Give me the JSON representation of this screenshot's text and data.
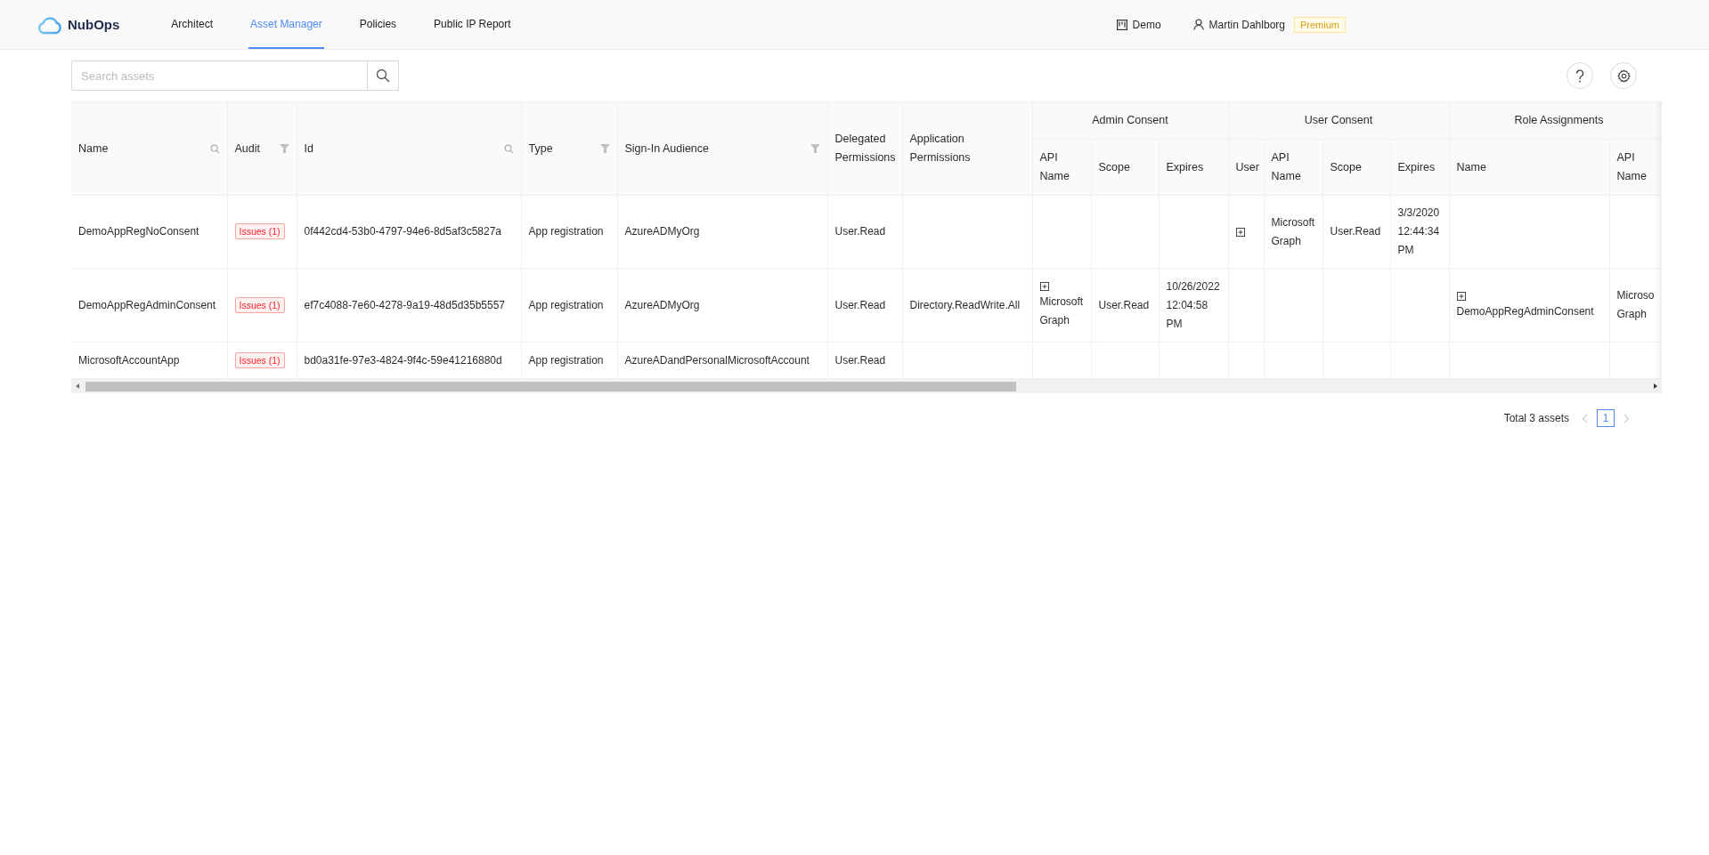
{
  "header": {
    "logo": "NubOps",
    "nav": [
      {
        "label": "Architect",
        "selected": false
      },
      {
        "label": "Asset Manager",
        "selected": true
      },
      {
        "label": "Policies",
        "selected": false
      },
      {
        "label": "Public IP Report",
        "selected": false
      }
    ],
    "workspace": "Demo",
    "user": "Martin Dahlborg",
    "plan_badge": "Premium"
  },
  "search": {
    "placeholder": "Search assets"
  },
  "table": {
    "columns": [
      {
        "label": "Name",
        "searchable": true,
        "filterable": false
      },
      {
        "label": "Audit",
        "searchable": false,
        "filterable": true
      },
      {
        "label": "Id",
        "searchable": true,
        "filterable": false
      },
      {
        "label": "Type",
        "searchable": false,
        "filterable": true
      },
      {
        "label": "Sign-In Audience",
        "searchable": false,
        "filterable": true
      },
      {
        "label": "Delegated Permissions",
        "searchable": false,
        "filterable": false
      },
      {
        "label": "Application Permissions",
        "searchable": false,
        "filterable": false
      }
    ],
    "column_groups": [
      {
        "label": "Admin Consent",
        "columns": [
          {
            "label": "API Name"
          },
          {
            "label": "Scope"
          },
          {
            "label": "Expires"
          }
        ]
      },
      {
        "label": "User Consent",
        "columns": [
          {
            "label": "User"
          },
          {
            "label": "API Name"
          },
          {
            "label": "Scope"
          },
          {
            "label": "Expires"
          }
        ]
      },
      {
        "label": "Role Assignments",
        "columns": [
          {
            "label": "Name"
          },
          {
            "label": "API Name"
          }
        ]
      }
    ],
    "rows": [
      {
        "cells": [
          "DemoAppRegNoConsent",
          {
            "kind": "badge",
            "text": "Issues (1)"
          },
          "0f442cd4-53b0-4797-94e6-8d5af3c5827a",
          "App registration",
          "AzureADMyOrg",
          "User.Read",
          null,
          null,
          null,
          null,
          {
            "kind": "expand",
            "expanded": false
          },
          "Microsoft Graph",
          "User.Read",
          "3/3/2020 12:44:34 PM",
          null,
          null
        ]
      },
      {
        "cells": [
          "DemoAppRegAdminConsent",
          {
            "kind": "badge",
            "text": "Issues (1)"
          },
          "ef7c4088-7e60-4278-9a19-48d5d35b5557",
          "App registration",
          "AzureADMyOrg",
          "User.Read",
          "Directory.ReadWrite.All",
          {
            "kind": "expand",
            "expanded": false,
            "text": "Microsoft Graph"
          },
          "User.Read",
          "10/26/2022 12:04:58 PM",
          null,
          null,
          null,
          null,
          {
            "kind": "expand",
            "expanded": false,
            "text": "DemoAppRegAdminConsent"
          },
          "Microso Graph"
        ]
      },
      {
        "cells": [
          "MicrosoftAccountApp",
          {
            "kind": "badge",
            "text": "Issues (1)"
          },
          "bd0a31fe-97e3-4824-9f4c-59e41216880d",
          "App registration",
          "AzureADandPersonalMicrosoftAccount",
          "User.Read",
          null,
          null,
          null,
          null,
          null,
          null,
          null,
          null,
          null,
          null
        ]
      }
    ]
  },
  "pagination": {
    "total": "Total 3 assets",
    "prev": {
      "disabled": true
    },
    "pages": [
      {
        "label": "1",
        "selected": true
      }
    ],
    "next": {
      "disabled": true
    }
  }
}
